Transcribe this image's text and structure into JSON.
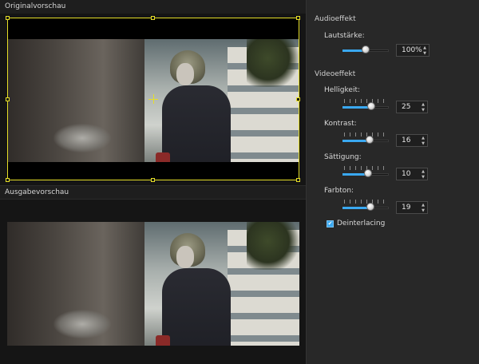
{
  "preview": {
    "original_title": "Originalvorschau",
    "output_title": "Ausgabevorschau"
  },
  "audio": {
    "section_title": "Audioeffekt",
    "volume": {
      "label": "Lautstärke:",
      "value_text": "100%",
      "level_fraction": 0.5
    }
  },
  "video": {
    "section_title": "Videoeffekt",
    "controls": [
      {
        "label": "Helligkeit:",
        "value_text": "25",
        "level_fraction": 0.62
      },
      {
        "label": "Kontrast:",
        "value_text": "16",
        "level_fraction": 0.58
      },
      {
        "label": "Sättigung:",
        "value_text": "10",
        "level_fraction": 0.55
      },
      {
        "label": "Farbton:",
        "value_text": "19",
        "level_fraction": 0.6
      }
    ],
    "deinterlacing": {
      "label": "Deinterlacing",
      "checked": true
    }
  },
  "colors": {
    "accent": "#3aa8f0",
    "crop_frame": "#e6df27",
    "panel_bg": "#282828"
  }
}
